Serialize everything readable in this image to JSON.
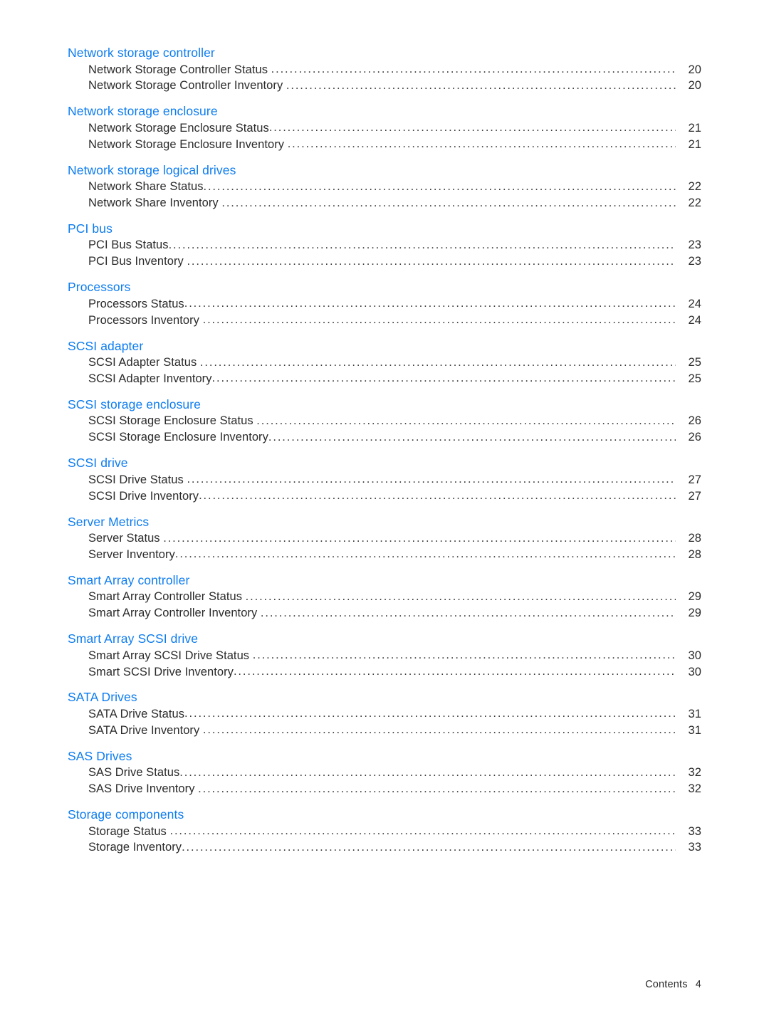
{
  "document": {
    "section_title": "Contents",
    "heading_color": "#0c7cf0",
    "body_color": "#2b2b2b"
  },
  "footer": {
    "label": "Contents",
    "page_number": "4"
  },
  "toc": {
    "groups": [
      {
        "heading": "Network storage controller",
        "entries": [
          {
            "title": "Network Storage Controller Status ",
            "page": "20"
          },
          {
            "title": "Network Storage Controller Inventory ",
            "page": "20"
          }
        ]
      },
      {
        "heading": "Network storage enclosure",
        "entries": [
          {
            "title": "Network Storage Enclosure Status",
            "page": "21"
          },
          {
            "title": "Network Storage Enclosure Inventory ",
            "page": "21"
          }
        ]
      },
      {
        "heading": "Network storage logical drives",
        "entries": [
          {
            "title": "Network Share Status",
            "page": "22"
          },
          {
            "title": "Network Share Inventory ",
            "page": "22"
          }
        ]
      },
      {
        "heading": "PCI bus",
        "entries": [
          {
            "title": "PCI Bus Status",
            "page": "23"
          },
          {
            "title": "PCI Bus Inventory ",
            "page": "23"
          }
        ]
      },
      {
        "heading": "Processors",
        "entries": [
          {
            "title": "Processors Status",
            "page": "24"
          },
          {
            "title": "Processors Inventory ",
            "page": "24"
          }
        ]
      },
      {
        "heading": "SCSI adapter",
        "entries": [
          {
            "title": "SCSI Adapter Status ",
            "page": "25"
          },
          {
            "title": "SCSI Adapter Inventory",
            "page": "25"
          }
        ]
      },
      {
        "heading": "SCSI storage enclosure",
        "entries": [
          {
            "title": "SCSI Storage Enclosure Status ",
            "page": "26"
          },
          {
            "title": "SCSI Storage Enclosure Inventory",
            "page": "26"
          }
        ]
      },
      {
        "heading": "SCSI drive",
        "entries": [
          {
            "title": "SCSI Drive Status ",
            "page": "27"
          },
          {
            "title": "SCSI Drive Inventory",
            "page": "27"
          }
        ]
      },
      {
        "heading": "Server Metrics",
        "entries": [
          {
            "title": "Server Status ",
            "page": "28"
          },
          {
            "title": "Server Inventory",
            "page": "28"
          }
        ]
      },
      {
        "heading": "Smart Array controller",
        "entries": [
          {
            "title": "Smart Array Controller Status ",
            "page": "29"
          },
          {
            "title": "Smart Array Controller Inventory ",
            "page": "29"
          }
        ]
      },
      {
        "heading": "Smart Array SCSI drive",
        "entries": [
          {
            "title": "Smart Array SCSI Drive Status ",
            "page": "30"
          },
          {
            "title": "Smart SCSI Drive Inventory",
            "page": "30"
          }
        ]
      },
      {
        "heading": "SATA Drives",
        "entries": [
          {
            "title": "SATA Drive Status",
            "page": "31"
          },
          {
            "title": "SATA Drive Inventory ",
            "page": "31"
          }
        ]
      },
      {
        "heading": "SAS Drives",
        "entries": [
          {
            "title": "SAS Drive Status",
            "page": "32"
          },
          {
            "title": "SAS Drive Inventory ",
            "page": "32"
          }
        ]
      },
      {
        "heading": "Storage components",
        "entries": [
          {
            "title": "Storage Status ",
            "page": "33"
          },
          {
            "title": "Storage Inventory",
            "page": "33"
          }
        ]
      }
    ]
  }
}
